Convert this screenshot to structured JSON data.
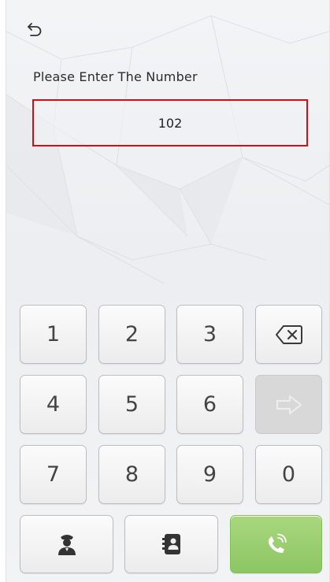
{
  "header": {
    "back_icon": "back-arrow-icon"
  },
  "prompt_text": "Please Enter The Number",
  "entry": {
    "value": "102"
  },
  "keypad": {
    "digits": [
      "1",
      "2",
      "3",
      "4",
      "5",
      "6",
      "7",
      "8",
      "9",
      "0"
    ],
    "backspace_icon": "backspace-icon",
    "enter_icon": "arrow-right-icon",
    "enter_enabled": false
  },
  "actions": {
    "guard_icon": "security-guard-icon",
    "contacts_icon": "contacts-book-icon",
    "call_icon": "phone-call-icon"
  },
  "colors": {
    "highlight_border": "#d60b16",
    "call_button": "#8cc663",
    "key_text": "#444444"
  }
}
